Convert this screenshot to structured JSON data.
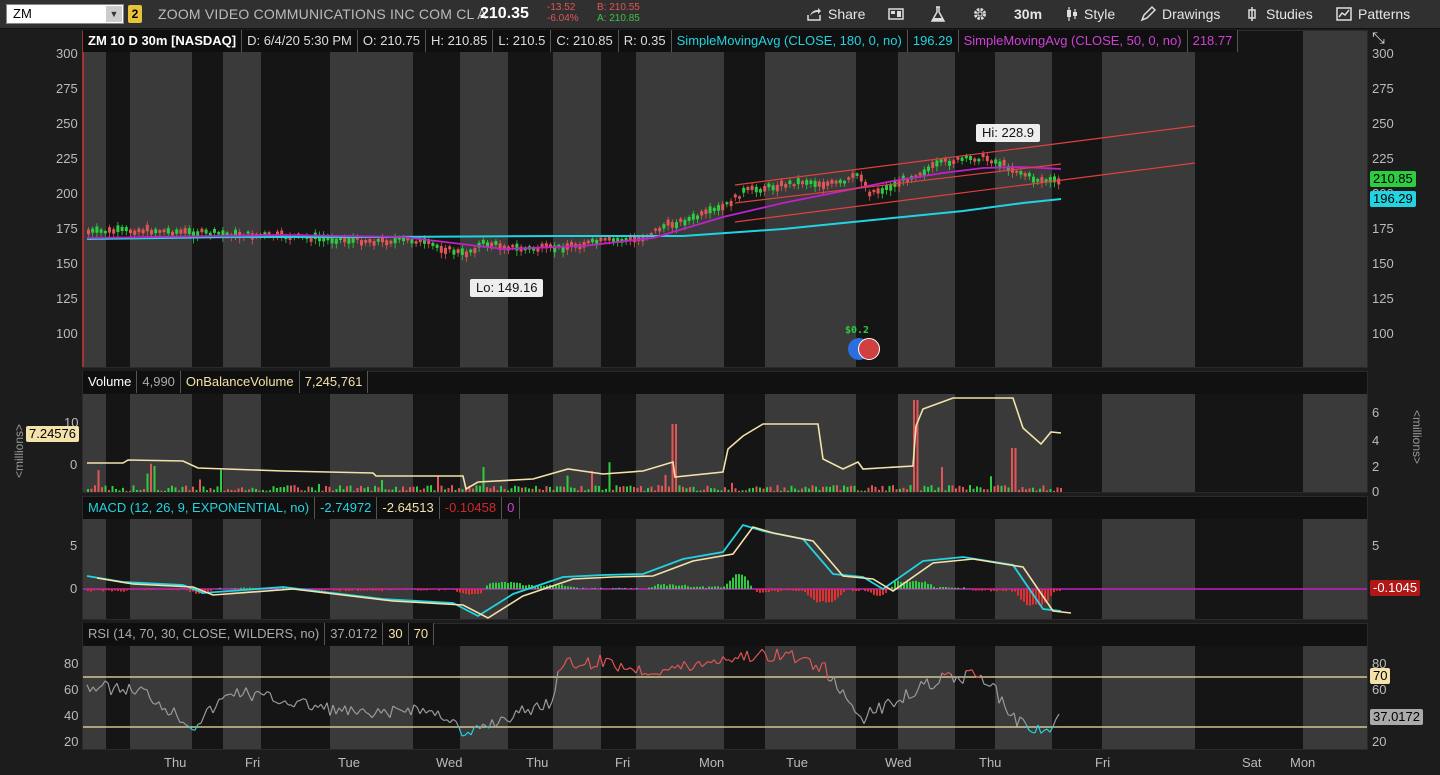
{
  "toolbar": {
    "symbol": "ZM",
    "link_number": "2",
    "company": "ZOOM VIDEO COMMUNICATIONS INC COM CL A",
    "last": "210.35",
    "net_change": "-13.52",
    "pct_change": "-6.04%",
    "bid": "B: 210.55",
    "ask": "A: 210.85",
    "share_label": "Share",
    "timeframe": "30m",
    "style_label": "Style",
    "drawings_label": "Drawings",
    "studies_label": "Studies",
    "patterns_label": "Patterns"
  },
  "price_header": {
    "title": "ZM 10 D 30m [NASDAQ]",
    "date": "D: 6/4/20 5:30 PM",
    "open": "O: 210.75",
    "high": "H: 210.85",
    "low": "L: 210.5",
    "close": "C: 210.85",
    "range": "R: 0.35",
    "sma1_label": "SimpleMovingAvg (CLOSE, 180, 0, no)",
    "sma1_value": "196.29",
    "sma2_label": "SimpleMovingAvg (CLOSE, 50, 0, no)",
    "sma2_value": "218.77"
  },
  "price_axis": [
    "300",
    "275",
    "250",
    "225",
    "200",
    "175",
    "150",
    "125",
    "100"
  ],
  "price_tags": {
    "last": "210.85",
    "sma180": "196.29"
  },
  "annotations": {
    "hi": "Hi: 228.9",
    "lo": "Lo: 149.16",
    "dividend": "$0.2"
  },
  "volume_header": {
    "volume_label": "Volume",
    "volume_value": "4,990",
    "obv_label": "OnBalanceVolume",
    "obv_value": "7,245,761"
  },
  "volume_axis_left": [
    "10",
    "0"
  ],
  "volume_axis_right": [
    "6",
    "4",
    "2",
    "0"
  ],
  "volume_tag": "7.24576",
  "volume_unit_label": "<millions>",
  "macd_header": {
    "label": "MACD (12, 26, 9, EXPONENTIAL, no)",
    "value": "-2.74972",
    "avg": "-2.64513",
    "diff": "-0.10458",
    "zero": "0"
  },
  "macd_axis": [
    "5",
    "0"
  ],
  "macd_tag": "-0.1045",
  "rsi_header": {
    "label": "RSI (14, 70, 30, CLOSE, WILDERS, no)",
    "value": "37.0172",
    "oversold": "30",
    "overbought": "70"
  },
  "rsi_axis": [
    "80",
    "60",
    "40",
    "20"
  ],
  "rsi_tags": {
    "ob": "70",
    "value": "37.0172"
  },
  "time_axis": [
    "Thu",
    "Fri",
    "Tue",
    "Wed",
    "Thu",
    "Fri",
    "Mon",
    "Tue",
    "Wed",
    "Thu",
    "Fri",
    "Sat",
    "Mon"
  ],
  "colors": {
    "up": "#2ecc40",
    "down": "#e05555",
    "sma180": "#22d3e0",
    "sma50": "#c020c8",
    "obv": "#f3e2a9",
    "channel": "#e04040"
  }
}
